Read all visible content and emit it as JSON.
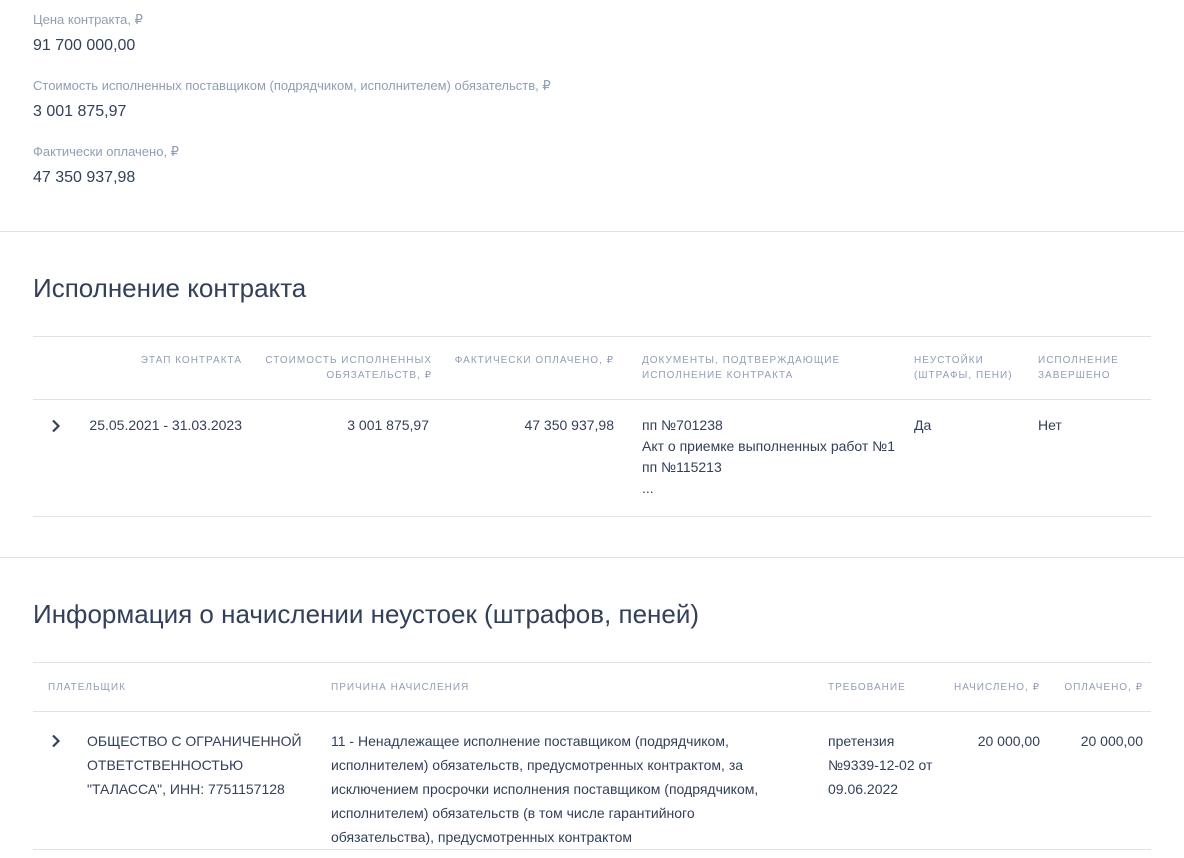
{
  "summary": {
    "contract_price_label": "Цена контракта, ₽",
    "contract_price_value": "91 700 000,00",
    "fulfilled_cost_label": "Стоимость исполненных поставщиком (подрядчиком, исполнителем) обязательств, ₽",
    "fulfilled_cost_value": "3 001 875,97",
    "paid_label": "Фактически оплачено, ₽",
    "paid_value": "47 350 937,98"
  },
  "execution": {
    "title": "Исполнение контракта",
    "headers": {
      "stage": "Этап контракта",
      "cost_line1": "Стоимость исполненных",
      "cost_line2": "обязательств, ₽",
      "paid": "Фактически оплачено, ₽",
      "docs_line1": "Документы, подтверждающие",
      "docs_line2": "исполнение контракта",
      "penalties_line1": "Неустойки",
      "penalties_line2": "(штрафы, пени)",
      "completed_line1": "Исполнение",
      "completed_line2": "завершено"
    },
    "rows": [
      {
        "stage": "25.05.2021 - 31.03.2023",
        "cost": "3 001 875,97",
        "paid": "47 350 937,98",
        "docs": [
          "пп №701238",
          "Акт о приемке выполненных работ №1",
          "пп №115213",
          "..."
        ],
        "penalties": "Да",
        "completed": "Нет"
      }
    ]
  },
  "penalties": {
    "title": "Информация о начислении неустоек (штрафов, пеней)",
    "headers": {
      "payer": "Плательщик",
      "reason": "Причина начисления",
      "demand": "Требование",
      "accrued": "Начислено, ₽",
      "paid": "Оплачено, ₽"
    },
    "rows": [
      {
        "payer": [
          "ОБЩЕСТВО С ОГРАНИЧЕННОЙ",
          "ОТВЕТСТВЕННОСТЬЮ",
          "\"ТАЛАССА\", ИНН: 7751157128"
        ],
        "reason": [
          "11 - Ненадлежащее исполнение поставщиком (подрядчиком,",
          "исполнителем) обязательств, предусмотренных контрактом, за",
          "исключением просрочки исполнения поставщиком (подрядчиком,",
          "исполнителем) обязательств (в том числе гарантийного",
          "обязательства), предусмотренных контрактом"
        ],
        "demand": [
          "претензия",
          "№9339-12-02 от",
          "09.06.2022"
        ],
        "accrued": "20 000,00",
        "paid": "20 000,00"
      }
    ]
  }
}
